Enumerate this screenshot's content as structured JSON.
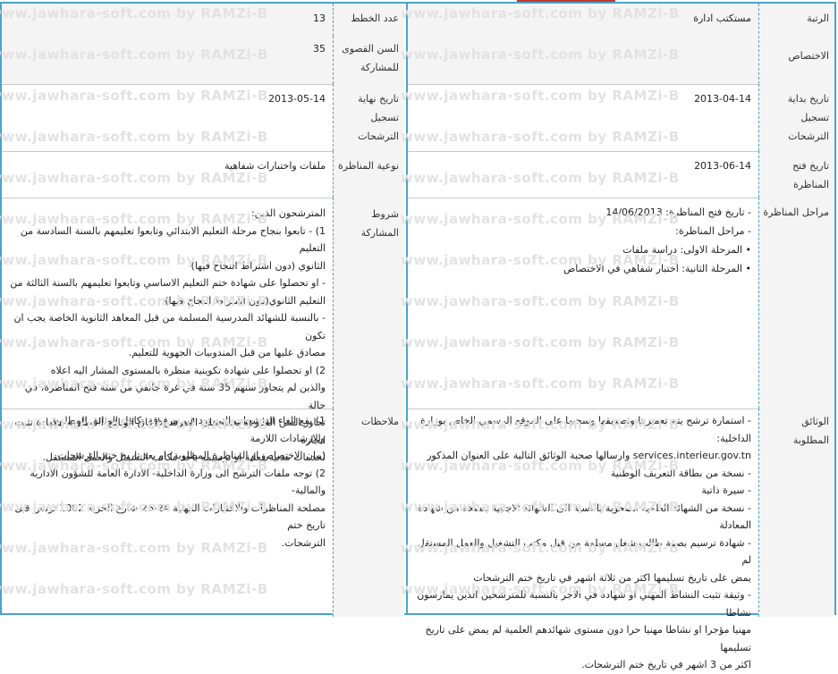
{
  "watermark": "www.jawhara-soft.com by RAMZi-B",
  "right_rows": [
    {
      "label_lines": [
        "الرتبة",
        "الاختصاص"
      ],
      "value_lines": [
        "مستكتب ادارة"
      ],
      "numeric": false
    },
    {
      "label_lines": [
        "تاريخ بداية",
        "تسجيل",
        "الترشحات"
      ],
      "value_lines": [
        "2013-04-14"
      ],
      "numeric": true
    },
    {
      "label_lines": [
        "تاريخ فتح",
        "المناظرة"
      ],
      "value_lines": [
        "2013-06-14"
      ],
      "numeric": true
    },
    {
      "label_lines": [
        "مراحل المناظرة"
      ],
      "value_lines": [
        "- تاريخ فتح المناظرة: 14/06/2013",
        "- مراحل المناظرة:",
        "• المرحلة الاولى: دراسة ملفات",
        "• المرحلة الثانية: اختبار شفاهي في الاختصاص"
      ],
      "numeric": false
    },
    {
      "label_lines": [
        "الوثائق المطلوبة"
      ],
      "value_lines": [
        "- استمارة ترشح يتم تعميرها وتصديقها وسحبها على الموقع الرسمي الخاص بوزارة الداخلية:",
        "services.interieur.gov.tn وارسالها صحبة الوثائق التالية على العنوان المذكور",
        "- نسخة من بطاقة التعريف الوطنية",
        "- سيرة ذاتية",
        "- نسخة من الشهائد العلمية مصحوبة بالنسبة الى الشهائد الاجنبية بنسخة من شهادة",
        "المعادلة",
        "- شهادة ترسيم بصفة طالب شغل مسلمة من قبل مكتب التشغيل والعمل المستقل لم",
        "يمض على تاريخ تسليمها اكثر من ثلاثة اشهر في تاريخ ختم الترشحات",
        "- وثيقة تثبت النشاط المهني او شهادة في الاجر بالنسبة للمترشحين الذين يمارسون نشاطا",
        "مهنيا مؤجرا او نشاطا مهنيا حرا دون مستوى شهائدهم العلمية لم يمض على تاريخ تسليمها",
        "اكثر من 3 اشهر في تاريخ ختم الترشحات."
      ],
      "numeric": false
    }
  ],
  "left_rows": [
    {
      "label_lines": [
        "عدد الخطط"
      ],
      "value_lines": [
        "13"
      ],
      "numeric": true
    },
    {
      "label_lines": [
        "السن القصوى",
        "للمشاركة"
      ],
      "value_lines": [
        "35"
      ],
      "numeric": true
    },
    {
      "label_lines": [
        "تاريخ نهاية",
        "تسجيل",
        "الترشحات"
      ],
      "value_lines": [
        "2013-05-14"
      ],
      "numeric": true
    },
    {
      "label_lines": [
        "نوعية المناظرة"
      ],
      "value_lines": [
        "ملفات واختبارات شفاهية"
      ],
      "numeric": false
    },
    {
      "label_lines": [
        "شروط المشاركة"
      ],
      "value_lines": [
        "المترشحون الذين:",
        "1) - تابعوا بنجاح مرحلة التعليم الابتدائي وتابعوا تعليمهم بالسنة السادسة من التعليم",
        "الثانوي (دون اشتراط النجاح فيها)",
        "- او تحصلوا على شهادة ختم التعليم الاساسي وتابعوا تعليمهم بالسنة الثالثة من",
        "التعليم الثانوي(دون اشتراط النجاح فيها)",
        "- بالنسبة للشهائد المدرسية المسلمة من قبل المعاهد الثانوية الخاصة يجب ان تكون",
        "مصادق عليها من قبل المندوبيات الجهوية للتعليم.",
        "2) او تحصلوا على شهادة تكوينية منظرة بالمستوى المشار اليه اعلاه",
        "والذين لم يتجاوز سنهم 35 سنة في غرة جانفي من سنة فتح المناظرة، في حالة",
        "تجاوز السن القانونية يجب على المترشح ارفاق الوثائق المطلوبة بشهادة تثبت انجازه",
        "لخدمات مدنية فعلية او ترسيمه باحد مكاتب التشغيل والعمل المستقل."
      ],
      "numeric": false
    },
    {
      "label_lines": [
        "ملاحظات"
      ],
      "value_lines": [
        "1) يقع الغاء الترشحات التي ترد غير مرفوقة بكامل الوثائق المطلوبة والارشادات اللازمة",
        "(بيان الاختصاص او المناظرة المطلوبة) او بعد تاريخ ختم الترشحات.",
        "2) توجه ملفات الترشح الى وزارة الداخلية- الادارة العامة للشؤون الادارية والمالية-",
        "مصلحة المناظرات والاختبارات المهنية 24-26 شارع الحرية 1002 تونس قبل تاريخ ختم",
        "الترشحات."
      ],
      "numeric": false
    }
  ]
}
